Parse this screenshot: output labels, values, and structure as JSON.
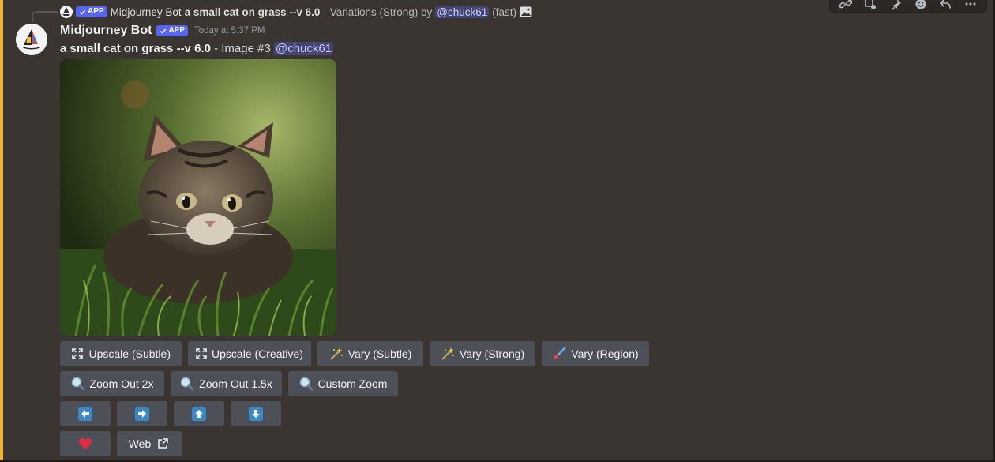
{
  "reply": {
    "bot_name": "Midjourney Bot",
    "app_badge": "APP",
    "prompt": "a small cat on grass --v 6.0",
    "suffix": " - Variations (Strong) by",
    "mention": "@chuck61",
    "speed": "(fast)"
  },
  "message": {
    "username": "Midjourney Bot",
    "app_badge": "APP",
    "timestamp": "Today at 5:37 PM",
    "prompt": "a small cat on grass --v 6.0",
    "image_label": " - Image #3 ",
    "mention": "@chuck61"
  },
  "buttons": {
    "row1": [
      {
        "label": "Upscale (Subtle)",
        "icon": "expand-icon"
      },
      {
        "label": "Upscale (Creative)",
        "icon": "expand-icon"
      },
      {
        "label": "Vary (Subtle)",
        "icon": "magic-wand-icon"
      },
      {
        "label": "Vary (Strong)",
        "icon": "magic-wand-icon"
      },
      {
        "label": "Vary (Region)",
        "icon": "paintbrush-icon"
      }
    ],
    "row2": [
      {
        "label": "Zoom Out 2x",
        "icon": "magnifier-icon"
      },
      {
        "label": "Zoom Out 1.5x",
        "icon": "magnifier-icon"
      },
      {
        "label": "Custom Zoom",
        "icon": "magnifier-icon"
      }
    ],
    "row3": [
      {
        "icon": "arrow-left-icon"
      },
      {
        "icon": "arrow-right-icon"
      },
      {
        "icon": "arrow-up-icon"
      },
      {
        "icon": "arrow-down-icon"
      }
    ],
    "row4": [
      {
        "icon": "heart-icon"
      },
      {
        "label": "Web",
        "icon": "external-link-icon"
      }
    ]
  },
  "toolbar": {
    "icons": [
      "link-icon",
      "app-icon",
      "pin-icon",
      "add-reaction-icon",
      "reply-icon",
      "more-icon"
    ]
  },
  "colors": {
    "background": "#3a3530",
    "mention_bar": "#f0b232",
    "button": "#4e5058",
    "app_badge": "#5865f2"
  }
}
